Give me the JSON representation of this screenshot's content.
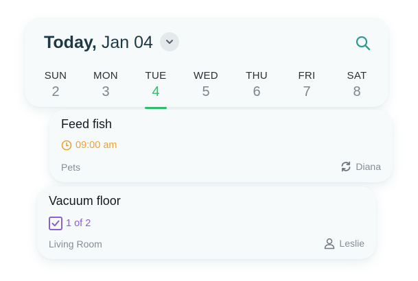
{
  "header": {
    "title_bold": "Today,",
    "title_date": "Jan 04",
    "expand_icon": "chevron-down-icon",
    "search_icon": "search-icon"
  },
  "week": {
    "selected_index": 2,
    "days": [
      {
        "name": "SUN",
        "date": "2"
      },
      {
        "name": "MON",
        "date": "3"
      },
      {
        "name": "TUE",
        "date": "4"
      },
      {
        "name": "WED",
        "date": "5"
      },
      {
        "name": "THU",
        "date": "6"
      },
      {
        "name": "FRI",
        "date": "7"
      },
      {
        "name": "SAT",
        "date": "8"
      }
    ]
  },
  "tasks": [
    {
      "title": "Feed fish",
      "meta_icon": "clock-icon",
      "meta_text": "09:00 am",
      "category": "Pets",
      "assignee_icon": "rotate-icon",
      "assignee": "Diana"
    },
    {
      "title": "Vacuum floor",
      "meta_icon": "checkbox-icon",
      "meta_text": "1 of 2",
      "category": "Living Room",
      "assignee_icon": "person-icon",
      "assignee": "Leslie"
    }
  ],
  "colors": {
    "accent_green": "#2fbf6a",
    "time_orange": "#e8a23a",
    "progress_purple": "#8a5fd3",
    "search_teal": "#2a9d8f"
  }
}
